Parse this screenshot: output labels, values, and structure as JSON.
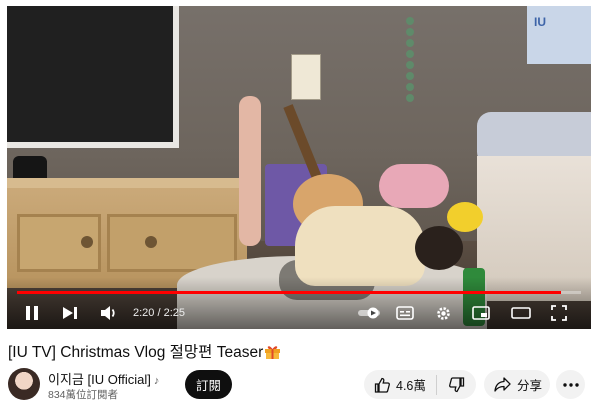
{
  "video": {
    "title": "[IU TV] Christmas Vlog 절망편 Teaser",
    "title_emoji": "gift-icon",
    "current_time": "2:20",
    "separator": " / ",
    "duration": "2:25",
    "progress": 0.965,
    "poster_text": "IU"
  },
  "channel": {
    "name": "이지금 [IU Official]",
    "note_icon": "♪",
    "subscribers": "834萬位訂閱者",
    "subscribe_label": "訂閱"
  },
  "actions": {
    "like_count": "4.6萬",
    "share_label": "分享"
  },
  "colors": {
    "progress": "#ff0000",
    "subscribe_bg": "#0f0f0f",
    "pill_bg": "#f2f2f2"
  }
}
